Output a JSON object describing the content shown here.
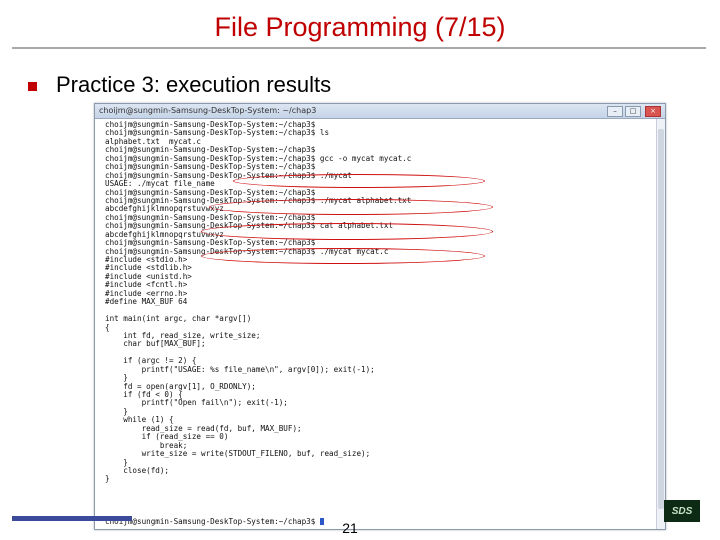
{
  "slide": {
    "title": "File Programming (7/15)",
    "bullet": "Practice 3: execution results",
    "page_number": "21",
    "logo_text": "SDS"
  },
  "terminal": {
    "window_title": "choijm@sungmin-Samsung-DeskTop-System: ~/chap3",
    "lines": [
      "choijm@sungmin-Samsung-DeskTop-System:~/chap3$",
      "choijm@sungmin-Samsung-DeskTop-System:~/chap3$ ls",
      "alphabet.txt  mycat.c",
      "choijm@sungmin-Samsung-DeskTop-System:~/chap3$",
      "choijm@sungmin-Samsung-DeskTop-System:~/chap3$ gcc -o mycat mycat.c",
      "choijm@sungmin-Samsung-DeskTop-System:~/chap3$",
      "choijm@sungmin-Samsung-DeskTop-System:~/chap3$ ./mycat",
      "USAGE: ./mycat file_name",
      "choijm@sungmin-Samsung-DeskTop-System:~/chap3$",
      "choijm@sungmin-Samsung-DeskTop-System:~/chap3$ ./mycat alphabet.txt",
      "abcdefghijklmnopqrstuvwxyz",
      "choijm@sungmin-Samsung-DeskTop-System:~/chap3$",
      "choijm@sungmin-Samsung-DeskTop-System:~/chap3$ cat alphabet.txt",
      "abcdefghijklmnopqrstuvwxyz",
      "choijm@sungmin-Samsung-DeskTop-System:~/chap3$",
      "choijm@sungmin-Samsung-DeskTop-System:~/chap3$ ./mycat mycat.c",
      "#include <stdio.h>",
      "#include <stdlib.h>",
      "#include <unistd.h>",
      "#include <fcntl.h>",
      "#include <errno.h>",
      "#define MAX_BUF 64",
      "",
      "int main(int argc, char *argv[])",
      "{",
      "    int fd, read_size, write_size;",
      "    char buf[MAX_BUF];",
      "",
      "    if (argc != 2) {",
      "        printf(\"USAGE: %s file_name\\n\", argv[0]); exit(-1);",
      "    }",
      "    fd = open(argv[1], O_RDONLY);",
      "    if (fd < 0) {",
      "        printf(\"Open fail\\n\"); exit(-1);",
      "    }",
      "    while (1) {",
      "        read_size = read(fd, buf, MAX_BUF);",
      "        if (read_size == 0)",
      "            break;",
      "        write_size = write(STDOUT_FILENO, buf, read_size);",
      "    }",
      "    close(fd);",
      "}",
      "",
      "",
      "",
      "",
      "choijm@sungmin-Samsung-DeskTop-System:~/chap3$ "
    ],
    "highlighted_commands": [
      "./mycat",
      "./mycat alphabet.txt",
      "cat alphabet.txt",
      "./mycat mycat.c"
    ],
    "highlight_color": "#d01010"
  },
  "colors": {
    "title": "#c00000",
    "bullet": "#c00000",
    "footer_bar": "#3b4a9a"
  }
}
